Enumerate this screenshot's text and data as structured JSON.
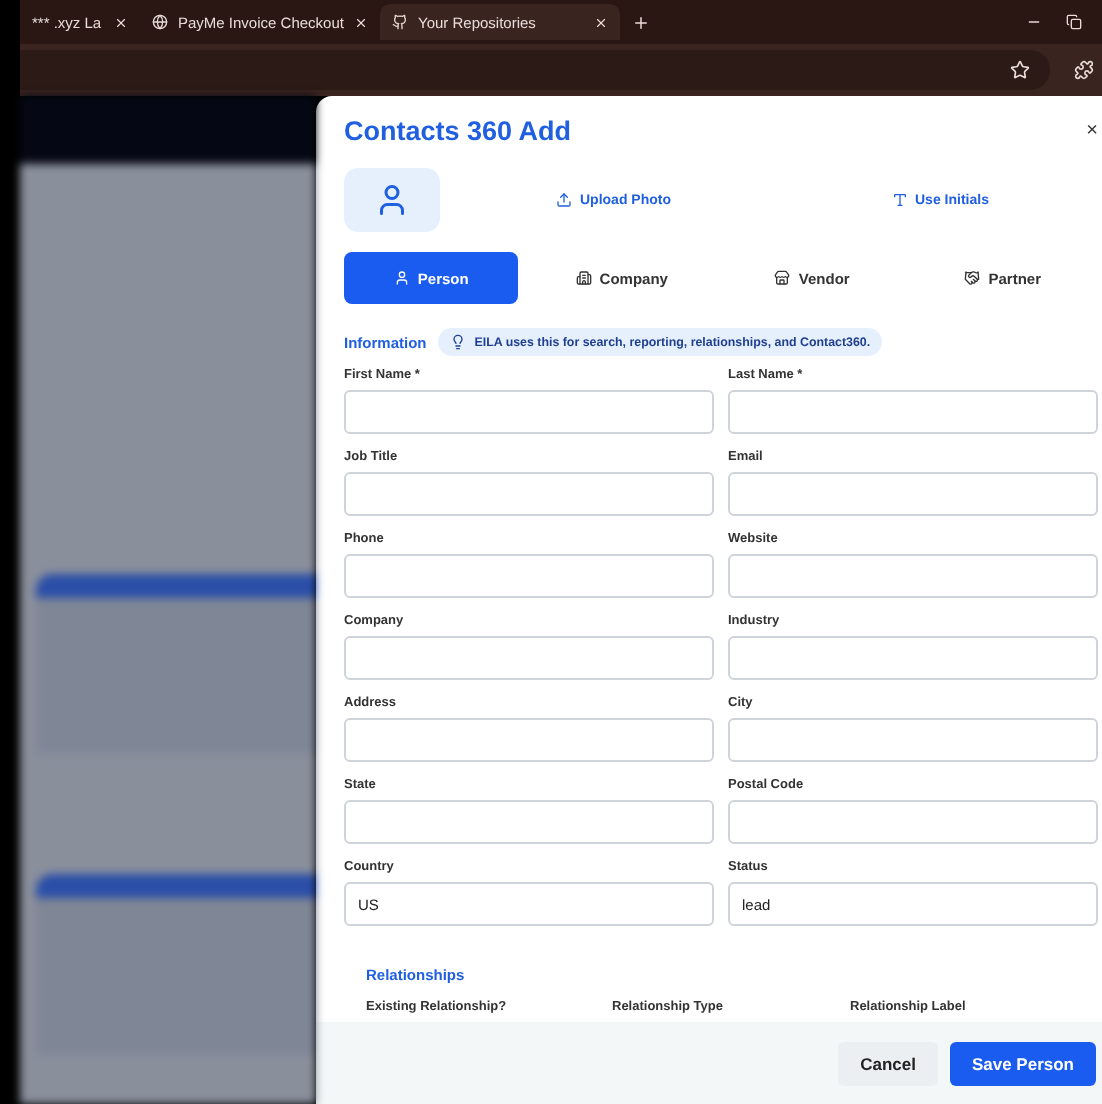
{
  "browser": {
    "tabs": [
      {
        "title": "*** .xyz La",
        "selected": false
      },
      {
        "title": "PayMe Invoice Checkout",
        "selected": false
      },
      {
        "title": "Your Repositories",
        "selected": true
      }
    ]
  },
  "modal": {
    "title": "Contacts 360 Add",
    "close": "×",
    "avatar_actions": [
      "Upload Photo",
      "Use Initials"
    ],
    "types": [
      {
        "label": "Person",
        "kind": "person",
        "selected": true
      },
      {
        "label": "Company",
        "kind": "company",
        "selected": false
      },
      {
        "label": "Vendor",
        "kind": "vendor",
        "selected": false
      },
      {
        "label": "Partner",
        "kind": "partner",
        "selected": false
      }
    ],
    "section": "Information",
    "hint": "EILA uses this for search, reporting, relationships, and Contact360.",
    "fields": [
      {
        "label": "First Name *"
      },
      {
        "label": "Last Name *"
      },
      {
        "label": "Job Title"
      },
      {
        "label": "Email"
      },
      {
        "label": "Phone"
      },
      {
        "label": "Website"
      },
      {
        "label": "Company"
      },
      {
        "label": "Industry"
      },
      {
        "label": "Address"
      },
      {
        "label": "City"
      },
      {
        "label": "State"
      },
      {
        "label": "Postal Code"
      },
      {
        "label": "Country",
        "value": "US"
      },
      {
        "label": "Status",
        "value": "lead"
      }
    ],
    "relationships": {
      "title": "Relationships",
      "labels": [
        "Existing Relationship?",
        "Relationship Type",
        "Relationship Label"
      ]
    },
    "buttons": {
      "cancel": "Cancel",
      "save": "Save Person"
    }
  }
}
